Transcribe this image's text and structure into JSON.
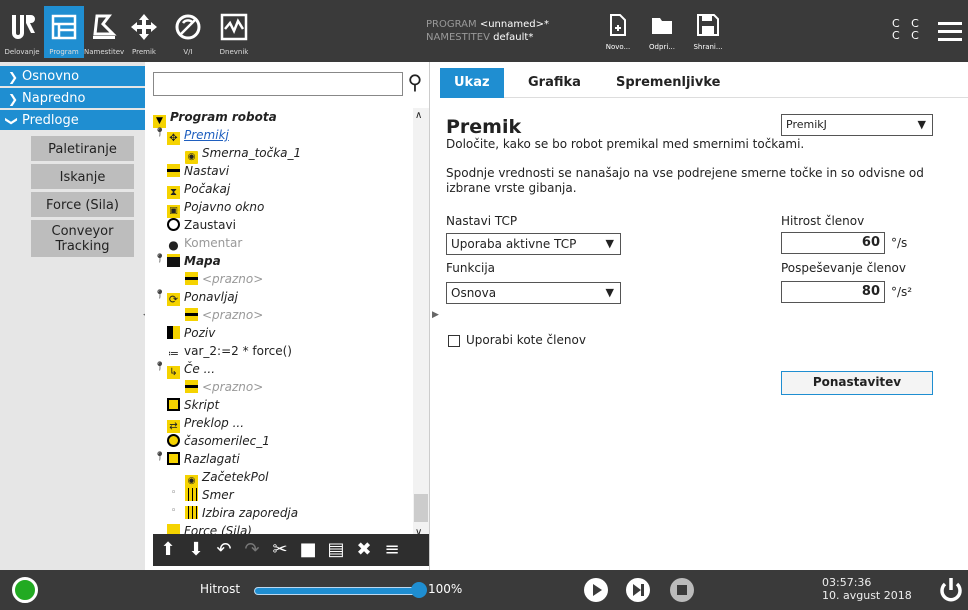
{
  "header": {
    "nav_buttons": [
      {
        "label": "Delovanje",
        "icon": "ur-logo-icon"
      },
      {
        "label": "Program",
        "icon": "program-icon",
        "active": true
      },
      {
        "label": "Namestitev",
        "icon": "installation-icon"
      },
      {
        "label": "Premik",
        "icon": "move-icon"
      },
      {
        "label": "V/I",
        "icon": "io-icon"
      },
      {
        "label": "Dnevnik",
        "icon": "log-icon"
      }
    ],
    "program_label": "PROGRAM",
    "program_value": "<unnamed>*",
    "installation_label": "NAMESTITEV",
    "installation_value": "default*",
    "file_buttons": [
      {
        "label": "Novo...",
        "icon": "new-file-icon"
      },
      {
        "label": "Odpri...",
        "icon": "open-folder-icon"
      },
      {
        "label": "Shrani...",
        "icon": "save-icon"
      }
    ],
    "cc_top": "C C",
    "cc_bottom": "C C"
  },
  "nav": {
    "sections": [
      {
        "label": "Osnovno",
        "expanded": false
      },
      {
        "label": "Napredno",
        "expanded": false
      },
      {
        "label": "Predloge",
        "expanded": true
      }
    ],
    "template_items": [
      "Paletiranje",
      "Iskanje",
      "Force (Sila)",
      "Conveyor Tracking"
    ]
  },
  "search": {
    "value": "",
    "placeholder": ""
  },
  "tree": [
    {
      "label": "Program robota",
      "style": "bold-italic"
    },
    {
      "label": "Premikj",
      "style": "italic",
      "selected": true
    },
    {
      "label": "Smerna_točka_1",
      "style": "italic"
    },
    {
      "label": "Nastavi",
      "style": "italic"
    },
    {
      "label": "Počakaj",
      "style": "italic"
    },
    {
      "label": "Pojavno okno",
      "style": "italic"
    },
    {
      "label": "Zaustavi",
      "style": "normal"
    },
    {
      "label": "Komentar",
      "style": "gray"
    },
    {
      "label": "Mapa",
      "style": "bold-italic"
    },
    {
      "label": "<prazno>",
      "style": "gray-italic"
    },
    {
      "label": "Ponavljaj",
      "style": "italic"
    },
    {
      "label": "<prazno>",
      "style": "gray-italic"
    },
    {
      "label": "Poziv",
      "style": "italic"
    },
    {
      "label": "var_2:=2 * force()",
      "style": "normal"
    },
    {
      "label": "Če ...",
      "style": "italic"
    },
    {
      "label": "<prazno>",
      "style": "gray-italic"
    },
    {
      "label": "Skript",
      "style": "italic"
    },
    {
      "label": "Preklop ...",
      "style": "italic"
    },
    {
      "label": "časomerilec_1",
      "style": "italic"
    },
    {
      "label": "Razlagati",
      "style": "italic"
    },
    {
      "label": "ZačetekPol",
      "style": "italic"
    },
    {
      "label": "Smer",
      "style": "italic"
    },
    {
      "label": "Izbira zaporedja",
      "style": "italic"
    },
    {
      "label": "Force (Sila)",
      "style": "italic"
    }
  ],
  "toolbar_icons": [
    "move-up-icon",
    "move-down-icon",
    "undo-icon",
    "redo-icon",
    "cut-icon",
    "copy-icon",
    "paste-icon",
    "delete-icon",
    "suppress-icon"
  ],
  "tabs": [
    "Ukaz",
    "Grafika",
    "Spremenljivke"
  ],
  "command": {
    "title": "Premik",
    "type_select": "PremikJ",
    "description": "Določite, kako se bo robot premikal med smernimi točkami.",
    "info": "Spodnje vrednosti se nanašajo na vse podrejene smerne točke in so odvisne od izbrane vrste gibanja.",
    "tcp_label": "Nastavi TCP",
    "tcp_value": "Uporaba aktivne TCP",
    "function_label": "Funkcija",
    "function_value": "Osnova",
    "joint_speed_label": "Hitrost členov",
    "joint_speed_value": "60",
    "joint_speed_unit": "°/s",
    "joint_accel_label": "Pospeševanje členov",
    "joint_accel_value": "80",
    "joint_accel_unit": "°/s²",
    "use_joint_angles_label": "Uporabi kote členov",
    "use_joint_angles_checked": false,
    "reset_label": "Ponastavitev"
  },
  "footer": {
    "speed_label": "Hitrost",
    "speed_value": "100%",
    "speed_fraction": 1.0,
    "time": "03:57:36",
    "date": "10. avgust 2018"
  },
  "colors": {
    "accent": "#1f8ed1",
    "header": "#3a3a3a",
    "status_green": "#22aa22",
    "icon_yellow": "#f5d300"
  }
}
